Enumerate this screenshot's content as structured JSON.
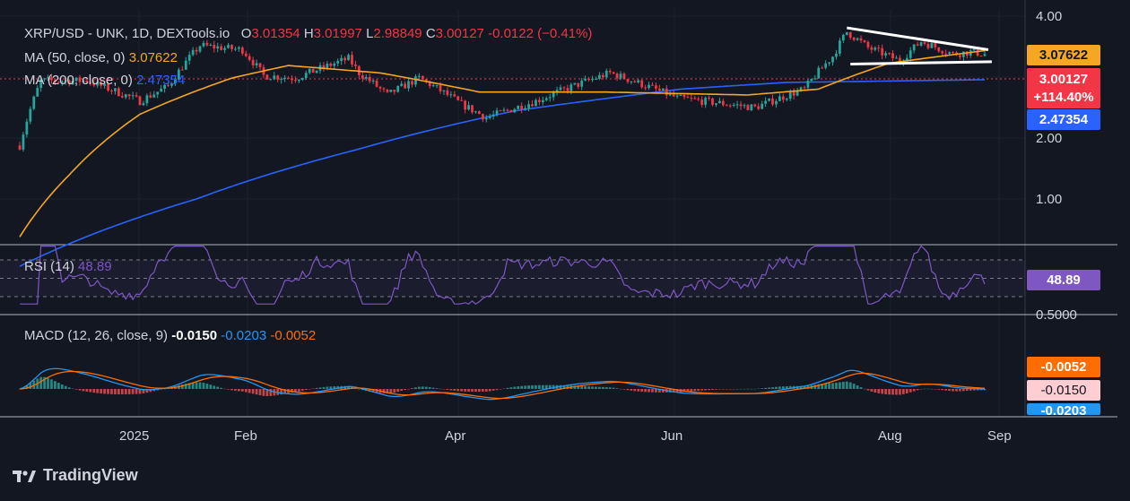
{
  "header": {
    "symbol": "XRP/USD - UNK, 1D, DEXTools.io",
    "o_label": "O",
    "o_value": "3.01354",
    "h_label": "H",
    "h_value": "3.01997",
    "l_label": "L",
    "l_value": "2.98849",
    "c_label": "C",
    "c_value": "3.00127",
    "change": "-0.0122 (−0.41%)"
  },
  "ma50": {
    "label": "MA (50, close, 0)",
    "value": "3.07622",
    "color": "#f5a623"
  },
  "ma200": {
    "label": "MA (200, close, 0)",
    "value": "2.47354",
    "color": "#2962ff"
  },
  "rsi": {
    "label": "RSI (14)",
    "value": "48.89",
    "color": "#7e57c2"
  },
  "macd": {
    "label": "MACD (12, 26, close, 9)",
    "hist_value": "-0.0150",
    "macd_value": "-0.0203",
    "signal_value": "-0.0052"
  },
  "price_tags": {
    "ma50": "3.07622",
    "close": "3.00127",
    "change_pct": "+114.40%",
    "ma200": "2.47354",
    "rsi": "48.89",
    "macd_signal": "-0.0052",
    "macd_hist": "-0.0150",
    "macd_line": "-0.0203"
  },
  "colors": {
    "up": "#26a69a",
    "down": "#f23645",
    "ma50": "#f5a623",
    "ma200": "#2962ff",
    "rsi": "#7e57c2",
    "macd": "#2196f3",
    "signal": "#ff6d00",
    "background": "#131722"
  },
  "axis": {
    "price_ticks": [
      "4.00",
      "2.00",
      "1.00"
    ],
    "rsi_tick": "0.5000",
    "x_labels": [
      "2025",
      "Feb",
      "Apr",
      "Jun",
      "Aug",
      "Sep"
    ]
  },
  "brand": "TradingView",
  "chart_data": {
    "type": "candlestick",
    "symbol": "XRP/USD",
    "interval": "1D",
    "scale": "log",
    "x_range": [
      "2024-11-26",
      "2025-08-26"
    ],
    "price_range": [
      0.72,
      4.2
    ],
    "price_key_points": [
      {
        "x": "2024-11-26",
        "y": 1.5
      },
      {
        "x": "2024-12-02",
        "y": 2.45
      },
      {
        "x": "2024-12-15",
        "y": 2.45
      },
      {
        "x": "2024-12-30",
        "y": 2.1
      },
      {
        "x": "2025-01-07",
        "y": 2.35
      },
      {
        "x": "2025-01-16",
        "y": 3.2
      },
      {
        "x": "2025-01-28",
        "y": 3.1
      },
      {
        "x": "2025-02-03",
        "y": 2.55
      },
      {
        "x": "2025-02-12",
        "y": 2.5
      },
      {
        "x": "2025-02-27",
        "y": 2.9
      },
      {
        "x": "2025-03-02",
        "y": 2.6
      },
      {
        "x": "2025-03-10",
        "y": 2.2
      },
      {
        "x": "2025-03-19",
        "y": 2.5
      },
      {
        "x": "2025-03-31",
        "y": 2.05
      },
      {
        "x": "2025-04-07",
        "y": 1.85
      },
      {
        "x": "2025-04-21",
        "y": 2.1
      },
      {
        "x": "2025-05-12",
        "y": 2.6
      },
      {
        "x": "2025-05-31",
        "y": 2.15
      },
      {
        "x": "2025-06-22",
        "y": 2.0
      },
      {
        "x": "2025-07-06",
        "y": 2.3
      },
      {
        "x": "2025-07-14",
        "y": 2.95
      },
      {
        "x": "2025-07-18",
        "y": 3.55
      },
      {
        "x": "2025-07-24",
        "y": 3.15
      },
      {
        "x": "2025-08-02",
        "y": 2.85
      },
      {
        "x": "2025-08-08",
        "y": 3.3
      },
      {
        "x": "2025-08-17",
        "y": 3.0
      },
      {
        "x": "2025-08-22",
        "y": 3.05
      },
      {
        "x": "2025-08-26",
        "y": 3.0
      }
    ],
    "ma50_key_points": [
      {
        "x": "2024-11-26",
        "y": 0.75
      },
      {
        "x": "2024-12-10",
        "y": 1.2
      },
      {
        "x": "2024-12-30",
        "y": 1.9
      },
      {
        "x": "2025-01-25",
        "y": 2.5
      },
      {
        "x": "2025-02-10",
        "y": 2.75
      },
      {
        "x": "2025-03-08",
        "y": 2.6
      },
      {
        "x": "2025-04-05",
        "y": 2.25
      },
      {
        "x": "2025-05-10",
        "y": 2.25
      },
      {
        "x": "2025-06-20",
        "y": 2.2
      },
      {
        "x": "2025-07-10",
        "y": 2.3
      },
      {
        "x": "2025-07-30",
        "y": 2.8
      },
      {
        "x": "2025-08-26",
        "y": 3.08
      }
    ],
    "ma200_key_points": [
      {
        "x": "2024-11-26",
        "y": 0.6
      },
      {
        "x": "2025-01-15",
        "y": 1.0
      },
      {
        "x": "2025-03-01",
        "y": 1.45
      },
      {
        "x": "2025-04-15",
        "y": 1.95
      },
      {
        "x": "2025-06-01",
        "y": 2.3
      },
      {
        "x": "2025-07-01",
        "y": 2.42
      },
      {
        "x": "2025-08-26",
        "y": 2.47
      }
    ],
    "trendlines": [
      {
        "name": "upper",
        "from": {
          "x": "2025-07-18",
          "y": 3.66
        },
        "to": {
          "x": "2025-08-27",
          "y": 3.1
        }
      },
      {
        "name": "lower",
        "from": {
          "x": "2025-07-19",
          "y": 2.78
        },
        "to": {
          "x": "2025-08-28",
          "y": 2.83
        }
      }
    ],
    "rsi_last": 48.89,
    "rsi_bands": [
      70,
      50,
      30
    ],
    "macd_last": {
      "macd": -0.0203,
      "signal": -0.0052,
      "histogram": -0.015
    }
  }
}
